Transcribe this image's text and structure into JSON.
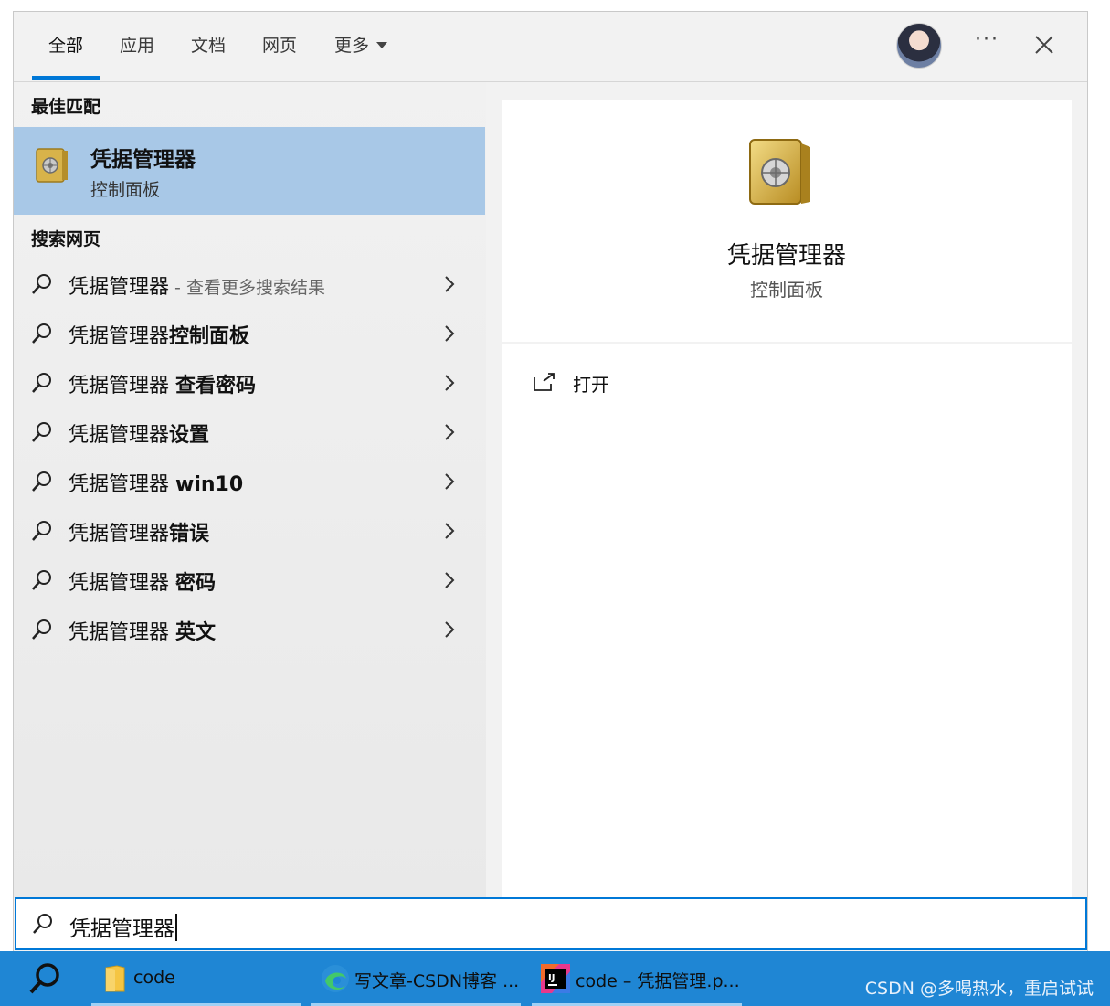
{
  "tabs": [
    {
      "label": "全部"
    },
    {
      "label": "应用"
    },
    {
      "label": "文档"
    },
    {
      "label": "网页"
    },
    {
      "label": "更多"
    }
  ],
  "header": {
    "more_dots": "···"
  },
  "best_match": {
    "section": "最佳匹配",
    "title": "凭据管理器",
    "subtitle": "控制面板"
  },
  "web": {
    "section": "搜索网页",
    "items": [
      {
        "prefix": "凭据管理器",
        "bold": "",
        "hint": " - 查看更多搜索结果"
      },
      {
        "prefix": "凭据管理器",
        "bold": "控制面板",
        "hint": ""
      },
      {
        "prefix": "凭据管理器 ",
        "bold": "查看密码",
        "hint": ""
      },
      {
        "prefix": "凭据管理器",
        "bold": "设置",
        "hint": ""
      },
      {
        "prefix": "凭据管理器 ",
        "bold": "win10",
        "hint": ""
      },
      {
        "prefix": "凭据管理器",
        "bold": "错误",
        "hint": ""
      },
      {
        "prefix": "凭据管理器 ",
        "bold": "密码",
        "hint": ""
      },
      {
        "prefix": "凭据管理器 ",
        "bold": "英文",
        "hint": ""
      }
    ]
  },
  "preview": {
    "title": "凭据管理器",
    "subtitle": "控制面板",
    "open_label": "打开"
  },
  "search": {
    "value": "凭据管理器"
  },
  "taskbar": {
    "items": [
      {
        "label": "code"
      },
      {
        "label": "写文章-CSDN博客 ..."
      },
      {
        "label": "code – 凭据管理.p..."
      }
    ],
    "watermark": "CSDN @多喝热水，重启试试"
  },
  "colors": {
    "accent": "#0078d7",
    "selected": "#a8c8e7",
    "taskbar": "#1f86d4"
  }
}
